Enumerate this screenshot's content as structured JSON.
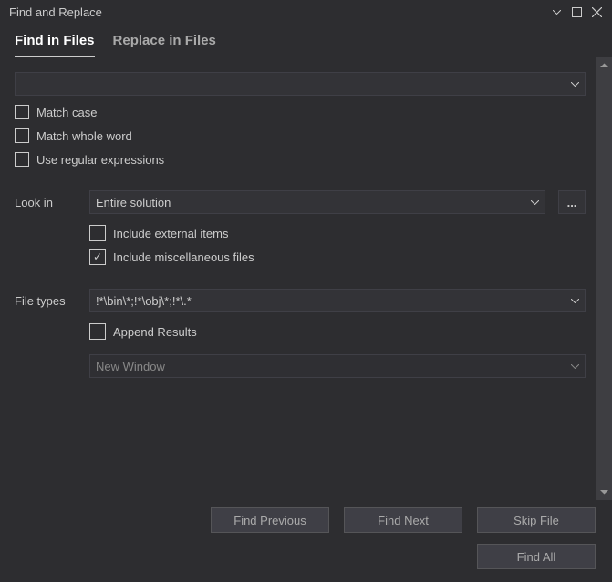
{
  "window": {
    "title": "Find and Replace"
  },
  "tabs": {
    "find": "Find in Files",
    "replace": "Replace in Files"
  },
  "search": {
    "value": ""
  },
  "options": {
    "matchCase": "Match case",
    "matchWord": "Match whole word",
    "useRegex": "Use regular expressions"
  },
  "lookIn": {
    "label": "Look in",
    "value": "Entire solution",
    "browse": "...",
    "includeExternal": "Include external items",
    "includeMisc": "Include miscellaneous files"
  },
  "fileTypes": {
    "label": "File types",
    "value": "!*\\bin\\*;!*\\obj\\*;!*\\.*"
  },
  "results": {
    "append": "Append Results",
    "windowValue": "New Window"
  },
  "buttons": {
    "findPrev": "Find Previous",
    "findNext": "Find Next",
    "skipFile": "Skip File",
    "findAll": "Find All"
  }
}
